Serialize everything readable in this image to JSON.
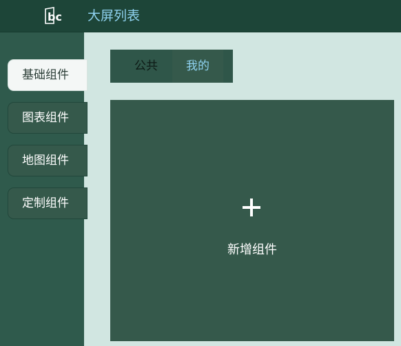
{
  "header": {
    "logo_text": "bc",
    "title": "大屏列表"
  },
  "sidebar": {
    "items": [
      {
        "label": "基础组件",
        "active": true
      },
      {
        "label": "图表组件",
        "active": false
      },
      {
        "label": "地图组件",
        "active": false
      },
      {
        "label": "定制组件",
        "active": false
      }
    ]
  },
  "tabs": [
    {
      "label": "公共",
      "active": false
    },
    {
      "label": "我的",
      "active": true
    }
  ],
  "main": {
    "add_card": {
      "icon": "plus-icon",
      "label": "新增组件"
    }
  },
  "colors": {
    "header_bg": "#1d4538",
    "sidebar_bg": "#2f5a4c",
    "content_bg": "#d1e6e1",
    "card_bg": "#35594b",
    "accent": "#8fd2f0"
  }
}
